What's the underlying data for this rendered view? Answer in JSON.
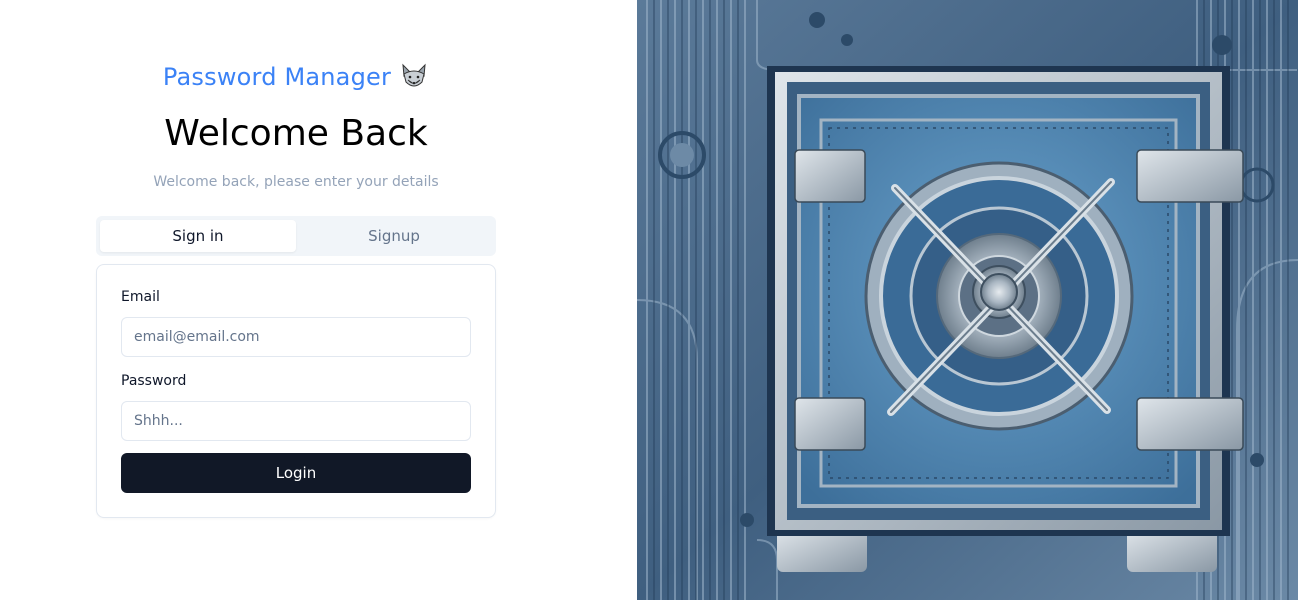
{
  "brand": {
    "title": "Password Manager",
    "logo_icon": "fox-icon"
  },
  "heading": {
    "title": "Welcome Back",
    "subtitle": "Welcome back, please enter your details"
  },
  "tabs": [
    {
      "label": "Sign in",
      "active": true
    },
    {
      "label": "Signup",
      "active": false
    }
  ],
  "form": {
    "email_label": "Email",
    "email_placeholder": "email@email.com",
    "password_label": "Password",
    "password_placeholder": "Shhh...",
    "submit_label": "Login"
  },
  "hero_image": {
    "icon": "vault-icon"
  },
  "colors": {
    "brand": "#3b82f6",
    "button": "#111827",
    "tab_bg": "#f1f5f9",
    "muted": "#94a3b8"
  }
}
